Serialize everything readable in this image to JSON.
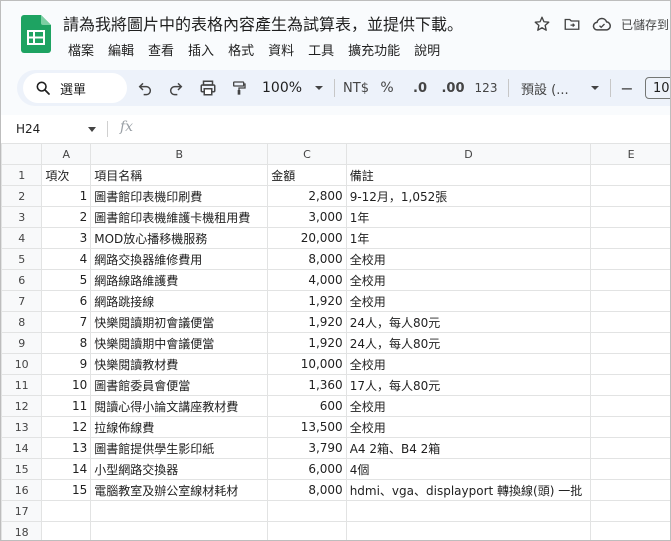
{
  "app": {
    "doc_title": "請為我將圖片中的表格內容產生為試算表，並提供下載。",
    "saved_status": "已儲存到"
  },
  "menu": [
    "檔案",
    "編輯",
    "查看",
    "插入",
    "格式",
    "資料",
    "工具",
    "擴充功能",
    "說明"
  ],
  "toolbar": {
    "search_label": "選單",
    "zoom": "100%",
    "currency": "NT$",
    "percent": "%",
    "dec_decrease": ".0",
    "dec_increase": ".00",
    "number_format": "123",
    "font": "預設 (...",
    "minus": "−",
    "font_size": "10"
  },
  "formula_bar": {
    "cell_ref": "H24",
    "fx": "fx",
    "value": ""
  },
  "columns": [
    "A",
    "B",
    "C",
    "D",
    "E"
  ],
  "rows": [
    {
      "n": "1",
      "a": "項次",
      "b": "項目名稱",
      "c": "金額",
      "d": "備註"
    },
    {
      "n": "2",
      "a": "1",
      "b": "圖書館印表機印刷費",
      "c": "2,800",
      "d": "9-12月，1,052張"
    },
    {
      "n": "3",
      "a": "2",
      "b": "圖書館印表機維護卡機租用費",
      "c": "3,000",
      "d": "1年"
    },
    {
      "n": "4",
      "a": "3",
      "b": "MOD放心播移機服務",
      "c": "20,000",
      "d": "1年"
    },
    {
      "n": "5",
      "a": "4",
      "b": "網路交換器維修費用",
      "c": "8,000",
      "d": "全校用"
    },
    {
      "n": "6",
      "a": "5",
      "b": "網路線路維護費",
      "c": "4,000",
      "d": "全校用"
    },
    {
      "n": "7",
      "a": "6",
      "b": "網路跳接線",
      "c": "1,920",
      "d": "全校用"
    },
    {
      "n": "8",
      "a": "7",
      "b": "快樂閱讀期初會議便當",
      "c": "1,920",
      "d": "24人，每人80元"
    },
    {
      "n": "9",
      "a": "8",
      "b": "快樂閱讀期中會議便當",
      "c": "1,920",
      "d": "24人，每人80元"
    },
    {
      "n": "10",
      "a": "9",
      "b": "快樂閱讀教材費",
      "c": "10,000",
      "d": "全校用"
    },
    {
      "n": "11",
      "a": "10",
      "b": "圖書館委員會便當",
      "c": "1,360",
      "d": "17人，每人80元"
    },
    {
      "n": "12",
      "a": "11",
      "b": "閱讀心得小論文講座教材費",
      "c": "600",
      "d": "全校用"
    },
    {
      "n": "13",
      "a": "12",
      "b": "拉線佈線費",
      "c": "13,500",
      "d": "全校用"
    },
    {
      "n": "14",
      "a": "13",
      "b": "圖書館提供學生影印紙",
      "c": "3,790",
      "d": "A4 2箱、B4 2箱"
    },
    {
      "n": "15",
      "a": "14",
      "b": "小型網路交換器",
      "c": "6,000",
      "d": "4個"
    },
    {
      "n": "16",
      "a": "15",
      "b": "電腦教室及辦公室線材耗材",
      "c": "8,000",
      "d": "hdmi、vga、displayport 轉換線(頭) 一批"
    },
    {
      "n": "17",
      "a": "",
      "b": "",
      "c": "",
      "d": ""
    },
    {
      "n": "18",
      "a": "",
      "b": "",
      "c": "",
      "d": ""
    }
  ]
}
